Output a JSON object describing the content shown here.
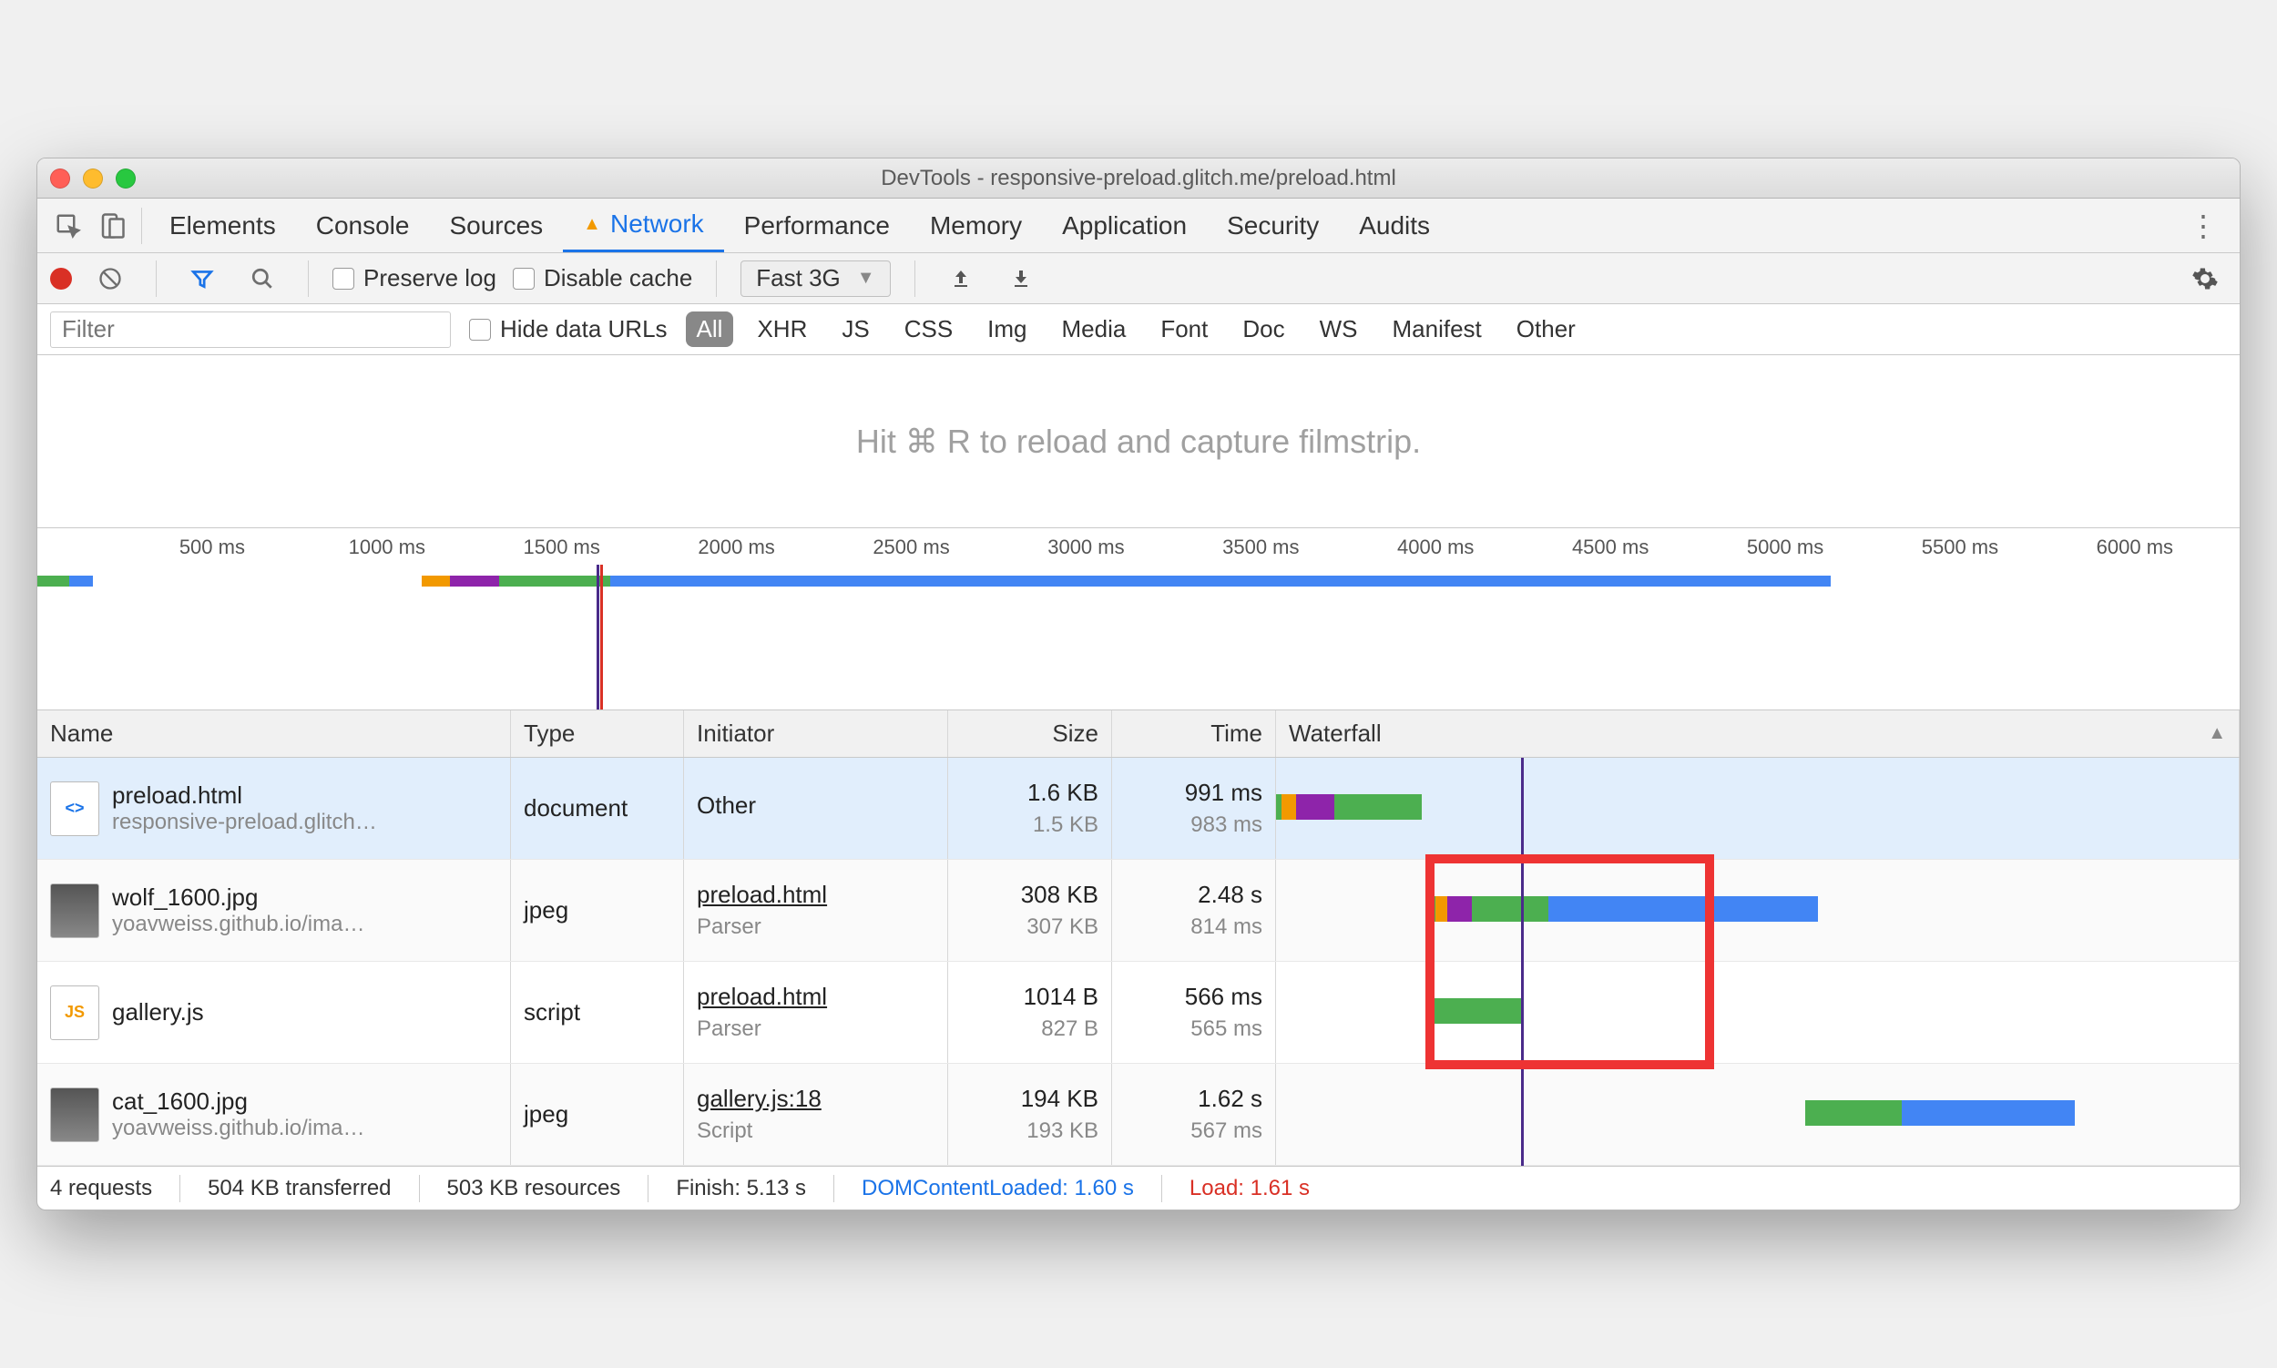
{
  "window": {
    "title": "DevTools - responsive-preload.glitch.me/preload.html"
  },
  "tabs": {
    "list": [
      "Elements",
      "Console",
      "Sources",
      "Network",
      "Performance",
      "Memory",
      "Application",
      "Security",
      "Audits"
    ],
    "active": "Network",
    "warning_on": "Network"
  },
  "toolbar": {
    "preserve": "Preserve log",
    "disable": "Disable cache",
    "throttle": "Fast 3G"
  },
  "filterbar": {
    "placeholder": "Filter",
    "hide": "Hide data URLs",
    "types": [
      "All",
      "XHR",
      "JS",
      "CSS",
      "Img",
      "Media",
      "Font",
      "Doc",
      "WS",
      "Manifest",
      "Other"
    ],
    "active": "All"
  },
  "filmstrip": {
    "hint": "Hit ⌘ R to reload and capture filmstrip."
  },
  "timeline": {
    "ticks": [
      "500 ms",
      "1000 ms",
      "1500 ms",
      "2000 ms",
      "2500 ms",
      "3000 ms",
      "3500 ms",
      "4000 ms",
      "4500 ms",
      "5000 ms",
      "5500 ms",
      "6000 ms"
    ],
    "max_ms": 6300,
    "dcl_ms": 1600,
    "load_ms": 1610,
    "overview": [
      {
        "start": 0,
        "end": 90,
        "color": "#4caf50"
      },
      {
        "start": 90,
        "end": 160,
        "color": "#4285f4"
      },
      {
        "start": 1100,
        "end": 1180,
        "color": "#f29900"
      },
      {
        "start": 1180,
        "end": 1320,
        "color": "#8e24aa"
      },
      {
        "start": 1320,
        "end": 1640,
        "color": "#4caf50"
      },
      {
        "start": 1640,
        "end": 4100,
        "color": "#4caf50"
      },
      {
        "start": 1640,
        "end": 5130,
        "color": "#4285f4"
      }
    ]
  },
  "columns": {
    "name": "Name",
    "type": "Type",
    "initiator": "Initiator",
    "size": "Size",
    "time": "Time",
    "waterfall": "Waterfall"
  },
  "rows": [
    {
      "name": "preload.html",
      "sub": "responsive-preload.glitch…",
      "type": "document",
      "initiator": "Other",
      "initiator_link": false,
      "initiator_sub": "",
      "size": "1.6 KB",
      "size_sub": "1.5 KB",
      "time": "991 ms",
      "time_sub": "983 ms",
      "icon": "html",
      "selected": true,
      "wf": [
        {
          "x": 0,
          "w": 0.6,
          "c": "#4caf50"
        },
        {
          "x": 0.6,
          "w": 1.5,
          "c": "#f29900"
        },
        {
          "x": 2.1,
          "w": 4,
          "c": "#8e24aa"
        },
        {
          "x": 6.1,
          "w": 9,
          "c": "#4caf50"
        }
      ]
    },
    {
      "name": "wolf_1600.jpg",
      "sub": "yoavweiss.github.io/ima…",
      "type": "jpeg",
      "initiator": "preload.html",
      "initiator_link": true,
      "initiator_sub": "Parser",
      "size": "308 KB",
      "size_sub": "307 KB",
      "time": "2.48 s",
      "time_sub": "814 ms",
      "icon": "img",
      "wf": [
        {
          "x": 16,
          "w": 0.6,
          "c": "#4caf50"
        },
        {
          "x": 16.6,
          "w": 1.2,
          "c": "#f29900"
        },
        {
          "x": 17.8,
          "w": 2.5,
          "c": "#8e24aa"
        },
        {
          "x": 20.3,
          "w": 8,
          "c": "#4caf50"
        },
        {
          "x": 28.3,
          "w": 28,
          "c": "#4285f4"
        }
      ]
    },
    {
      "name": "gallery.js",
      "sub": "",
      "type": "script",
      "initiator": "preload.html",
      "initiator_link": true,
      "initiator_sub": "Parser",
      "size": "1014 B",
      "size_sub": "827 B",
      "time": "566 ms",
      "time_sub": "565 ms",
      "icon": "js",
      "wf": [
        {
          "x": 16.5,
          "w": 9,
          "c": "#4caf50"
        }
      ]
    },
    {
      "name": "cat_1600.jpg",
      "sub": "yoavweiss.github.io/ima…",
      "type": "jpeg",
      "initiator": "gallery.js:18",
      "initiator_link": true,
      "initiator_sub": "Script",
      "size": "194 KB",
      "size_sub": "193 KB",
      "time": "1.62 s",
      "time_sub": "567 ms",
      "icon": "img2",
      "wf": [
        {
          "x": 55,
          "w": 10,
          "c": "#4caf50"
        },
        {
          "x": 65,
          "w": 18,
          "c": "#4285f4"
        }
      ]
    }
  ],
  "highlight": {
    "left_pct": 15,
    "width_pct": 30,
    "top_row": 1,
    "rows": 2
  },
  "status": {
    "requests": "4 requests",
    "transferred": "504 KB transferred",
    "resources": "503 KB resources",
    "finish": "Finish: 5.13 s",
    "dcl": "DOMContentLoaded: 1.60 s",
    "load": "Load: 1.61 s"
  }
}
